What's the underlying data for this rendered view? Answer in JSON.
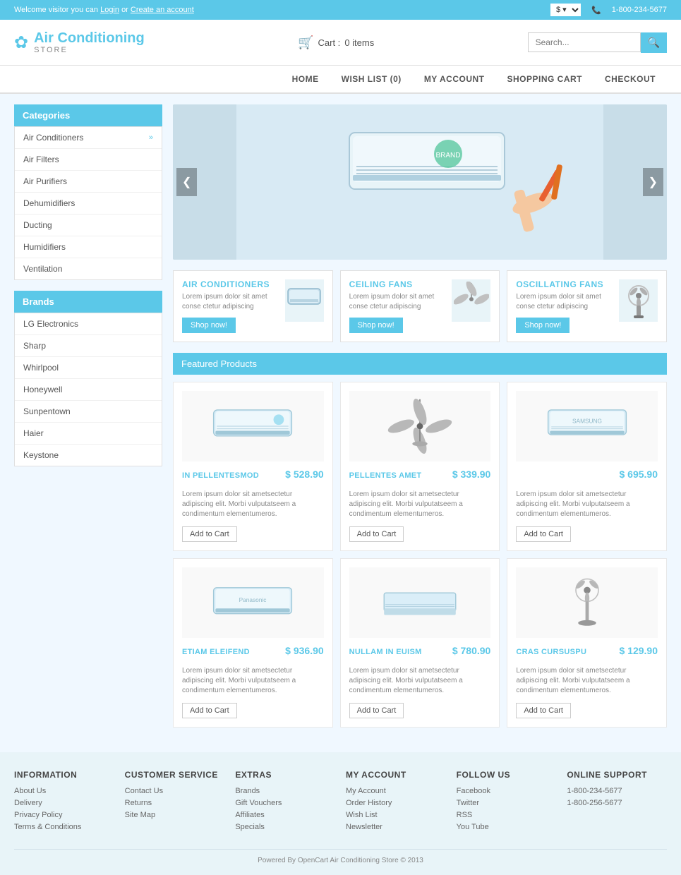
{
  "topbar": {
    "welcome_text": "Welcome visitor you can",
    "login_text": "Login",
    "or_text": "or",
    "create_account_text": "Create an account",
    "currency": "$",
    "phone": "1-800-234-5677"
  },
  "header": {
    "logo_name": "Air Conditioning",
    "logo_sub": "STORE",
    "cart_label": "Cart :",
    "cart_items": "0 items",
    "search_placeholder": "Search..."
  },
  "nav": {
    "items": [
      {
        "label": "HOME",
        "active": false
      },
      {
        "label": "WISH LIST (0)",
        "active": false
      },
      {
        "label": "MY ACCOUNT",
        "active": false
      },
      {
        "label": "SHOPPING CART",
        "active": false
      },
      {
        "label": "CHECKOUT",
        "active": false
      }
    ]
  },
  "categories": {
    "title": "Categories",
    "items": [
      {
        "label": "Air Conditioners",
        "has_arrow": true
      },
      {
        "label": "Air Filters",
        "has_arrow": false
      },
      {
        "label": "Air Purifiers",
        "has_arrow": false
      },
      {
        "label": "Dehumidifiers",
        "has_arrow": false
      },
      {
        "label": "Ducting",
        "has_arrow": false
      },
      {
        "label": "Humidifiers",
        "has_arrow": false
      },
      {
        "label": "Ventilation",
        "has_arrow": false
      }
    ]
  },
  "brands": {
    "title": "Brands",
    "items": [
      {
        "label": "LG Electronics"
      },
      {
        "label": "Sharp"
      },
      {
        "label": "Whirlpool"
      },
      {
        "label": "Honeywell"
      },
      {
        "label": "Sunpentown"
      },
      {
        "label": "Haier"
      },
      {
        "label": "Keystone"
      }
    ]
  },
  "promo_cards": [
    {
      "title": "AIR CONDITIONERS",
      "desc": "Lorem ipsum dolor sit amet conse ctetur adipiscing",
      "button": "Shop now!"
    },
    {
      "title": "CEILING FANS",
      "desc": "Lorem ipsum dolor sit amet conse ctetur adipiscing",
      "button": "Shop now!"
    },
    {
      "title": "OSCILLATING FANS",
      "desc": "Lorem ipsum dolor sit amet conse ctetur adipiscing",
      "button": "Shop now!"
    }
  ],
  "featured": {
    "title": "Featured Products",
    "products": [
      {
        "name": "IN PELLENTESMOD",
        "price": "$ 528.90",
        "desc": "Lorem ipsum dolor sit ametsectetur adipiscing elit. Morbi vulputatseem a condimentum elementumeros.",
        "button": "Add to Cart",
        "type": "ac"
      },
      {
        "name": "PELLENTES AMET",
        "price": "$ 339.90",
        "desc": "Lorem ipsum dolor sit ametsectetur adipiscing elit. Morbi vulputatseem a condimentum elementumeros.",
        "button": "Add to Cart",
        "type": "fan"
      },
      {
        "name": "",
        "price": "$ 695.90",
        "desc": "Lorem ipsum dolor sit ametsectetur adipiscing elit. Morbi vulputatseem a condimentum elementumeros.",
        "button": "Add to Cart",
        "type": "ac"
      },
      {
        "name": "ETIAM ELEIFEND",
        "price": "$ 936.90",
        "desc": "Lorem ipsum dolor sit ametsectetur adipiscing elit. Morbi vulputatseem a condimentum elementumeros.",
        "button": "Add to Cart",
        "type": "ac"
      },
      {
        "name": "NULLAM IN EUISM",
        "price": "$ 780.90",
        "desc": "Lorem ipsum dolor sit ametsectetur adipiscing elit. Morbi vulputatseem a condimentum elementumeros.",
        "button": "Add to Cart",
        "type": "ac_small"
      },
      {
        "name": "CRAS CURSUSPU",
        "price": "$ 129.90",
        "desc": "Lorem ipsum dolor sit ametsectetur adipiscing elit. Morbi vulputatseem a condimentum elementumeros.",
        "button": "Add to Cart",
        "type": "fan_stand"
      }
    ]
  },
  "footer": {
    "cols": [
      {
        "title": "INFORMATION",
        "links": [
          "About Us",
          "Delivery",
          "Privacy Policy",
          "Terms & Conditions"
        ]
      },
      {
        "title": "CUSTOMER SERVICE",
        "links": [
          "Contact Us",
          "Returns",
          "Site Map"
        ]
      },
      {
        "title": "EXTRAS",
        "links": [
          "Brands",
          "Gift Vouchers",
          "Affiliates",
          "Specials"
        ]
      },
      {
        "title": "MY ACCOUNT",
        "links": [
          "My Account",
          "Order History",
          "Wish List",
          "Newsletter"
        ]
      },
      {
        "title": "FOLLOW US",
        "links": [
          "Facebook",
          "Twitter",
          "RSS",
          "You Tube"
        ]
      },
      {
        "title": "ONLINE SUPPORT",
        "links": [
          "1-800-234-5677",
          "1-800-256-5677"
        ]
      }
    ],
    "copyright": "Powered By OpenCart Air Conditioning Store © 2013"
  }
}
